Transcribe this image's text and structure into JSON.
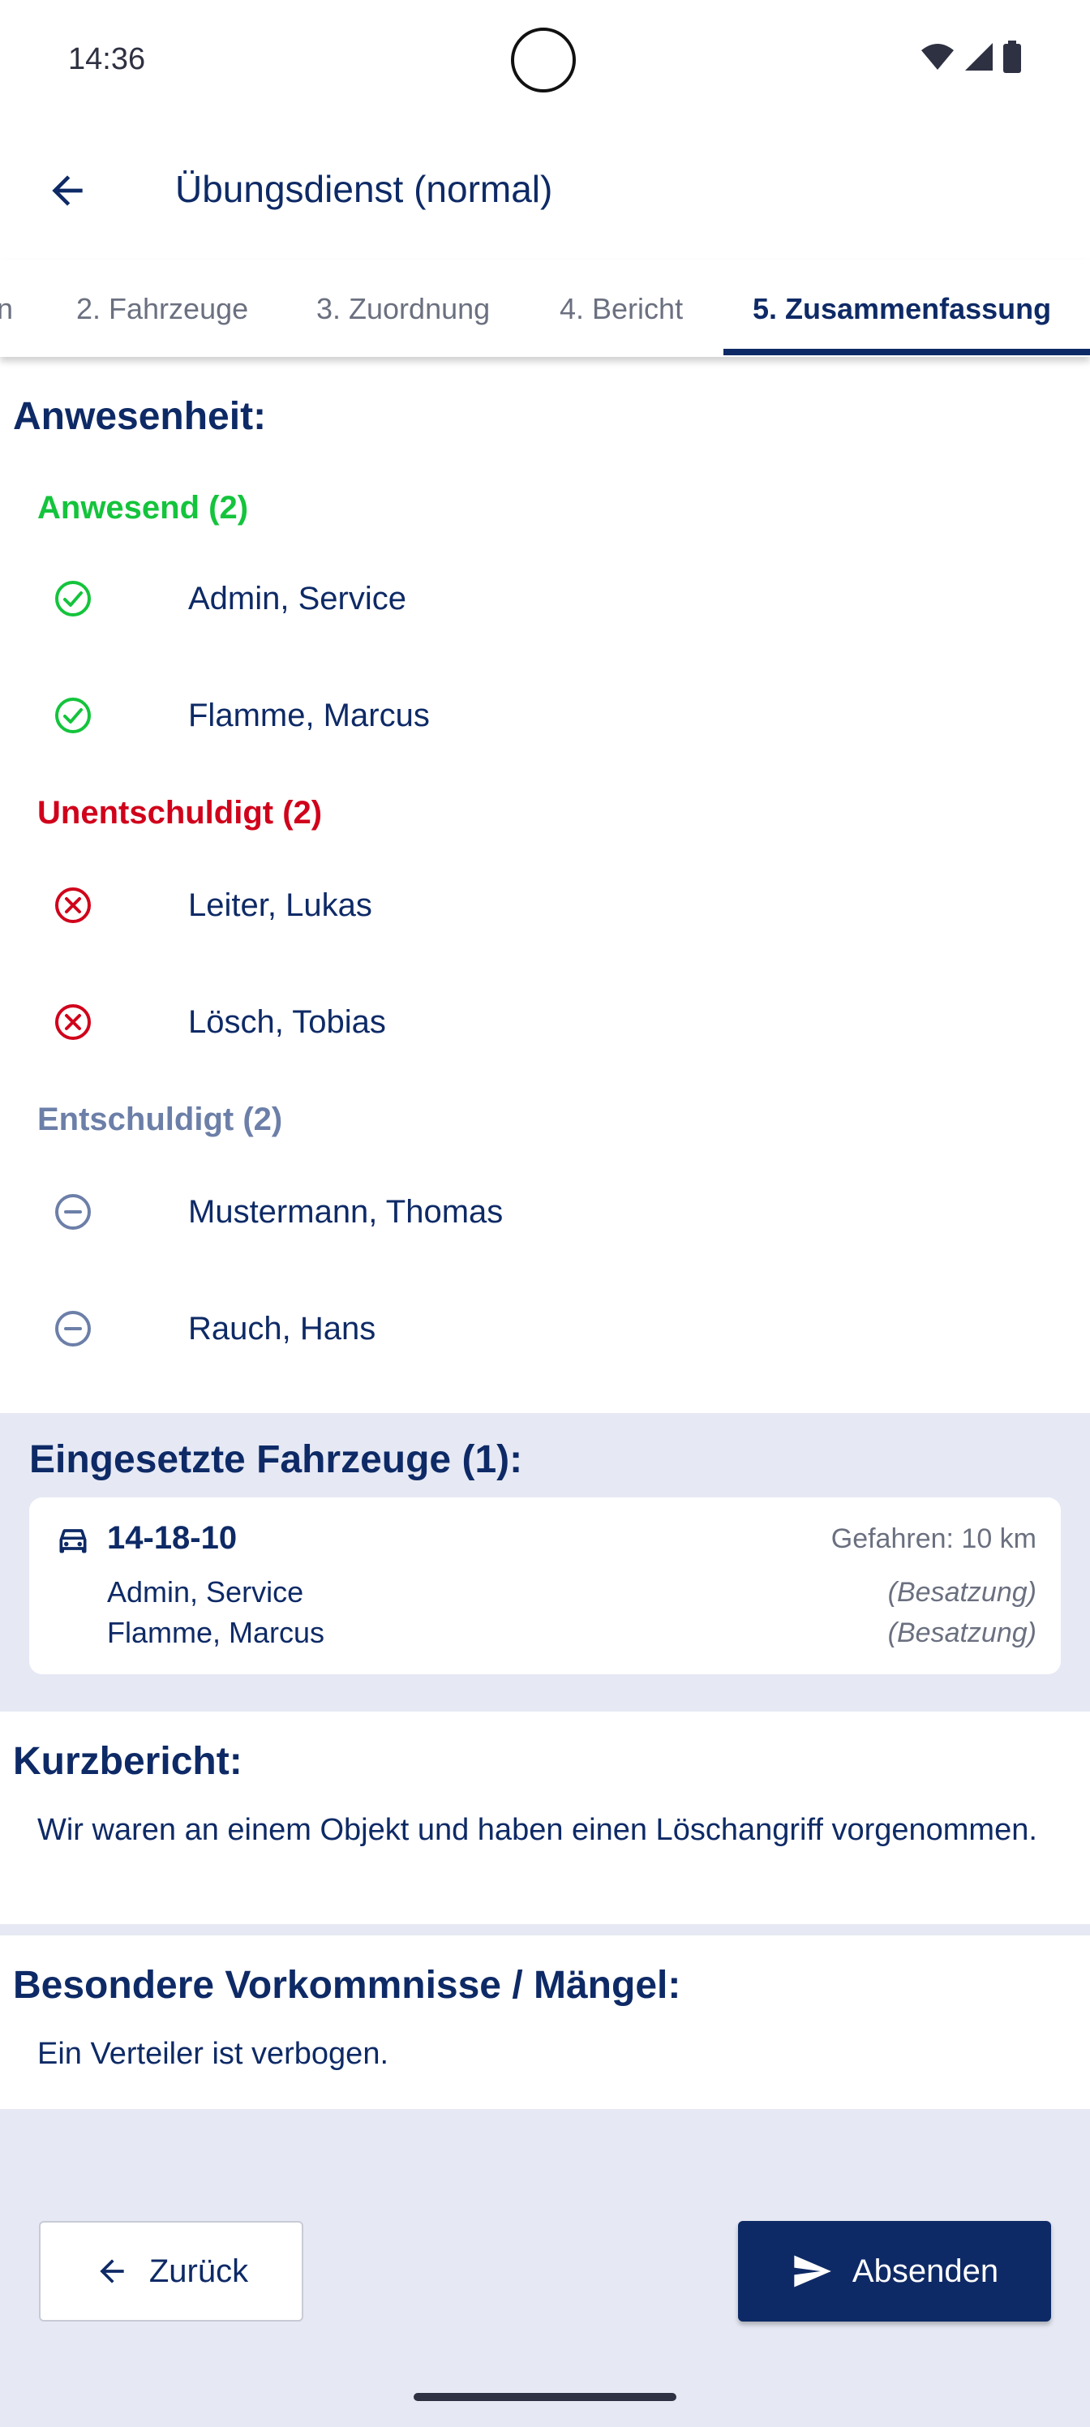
{
  "status_bar": {
    "time": "14:36"
  },
  "app_bar": {
    "title": "Übungsdienst (normal)"
  },
  "tabs": [
    {
      "label": "n"
    },
    {
      "label": "2. Fahrzeuge"
    },
    {
      "label": "3. Zuordnung"
    },
    {
      "label": "4. Bericht"
    },
    {
      "label": "5. Zusammenfassung"
    }
  ],
  "attendance": {
    "title": "Anwesenheit:",
    "groups": {
      "present": {
        "title": "Anwesend (2)",
        "color": "#14c43c",
        "people": [
          "Admin, Service",
          "Flamme, Marcus"
        ]
      },
      "unexcused": {
        "title": "Unentschuldigt (2)",
        "color": "#d0021b",
        "people": [
          "Leiter, Lukas",
          "Lösch, Tobias"
        ]
      },
      "excused": {
        "title": "Entschuldigt (2)",
        "color": "#6c7fa8",
        "people": [
          "Mustermann, Thomas",
          "Rauch, Hans"
        ]
      }
    }
  },
  "vehicles": {
    "title": "Eingesetzte Fahrzeuge (1):",
    "items": [
      {
        "name": "14-18-10",
        "distance": "Gefahren: 10 km",
        "crew": [
          {
            "name": "Admin, Service",
            "role": "(Besatzung)"
          },
          {
            "name": "Flamme, Marcus",
            "role": "(Besatzung)"
          }
        ]
      }
    ]
  },
  "short_report": {
    "title": "Kurzbericht:",
    "text": "Wir waren an einem Objekt und haben einen Löschangriff vorgenommen."
  },
  "incidents": {
    "title": "Besondere Vorkommnisse / Mängel:",
    "text": "Ein Verteiler ist verbogen."
  },
  "actions": {
    "back_label": "Zurück",
    "send_label": "Absenden"
  },
  "colors": {
    "primary": "#0e2a66",
    "present": "#14c43c",
    "unexcused": "#d0021b",
    "excused": "#6c7fa8",
    "section_bg": "#e6e9f4"
  }
}
